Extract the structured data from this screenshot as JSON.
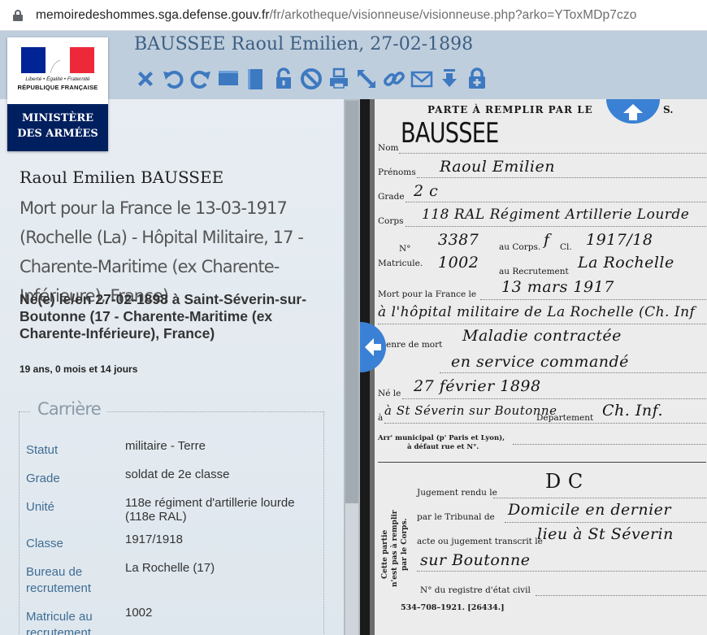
{
  "browser": {
    "url_host": "memoiredeshommes.sga.defense.gouv.fr",
    "url_path": "/fr/arkotheque/visionneuse/visionneuse.php?arko=YToxMDp7czo"
  },
  "header": {
    "title": "BAUSSEE Raoul Emilien, 27-02-1898",
    "toolbar": [
      {
        "name": "close-icon"
      },
      {
        "name": "rotate-left-icon"
      },
      {
        "name": "rotate-right-icon"
      },
      {
        "name": "fit-width-icon"
      },
      {
        "name": "fit-height-icon"
      },
      {
        "name": "unlock-icon"
      },
      {
        "name": "no-entry-icon"
      },
      {
        "name": "print-icon"
      },
      {
        "name": "fullscreen-icon"
      },
      {
        "name": "link-icon"
      },
      {
        "name": "mail-icon"
      },
      {
        "name": "download-icon"
      },
      {
        "name": "add-lock-icon"
      }
    ],
    "accent": "#3c5f82"
  },
  "logo": {
    "motto": "Liberté • Égalité • Fraternité",
    "republique": "RÉPUBLIQUE FRANÇAISE",
    "ministere_line1": "MINISTÈRE",
    "ministere_line2": "DES ARMÉES"
  },
  "person": {
    "name": "Raoul Emilien BAUSSEE",
    "death": "Mort pour la France le 13-03-1917 (Rochelle (La) - Hôpital Militaire, 17 - Charente-Maritime (ex Charente-Inférieure), France)",
    "birth": "Né(e) le/en 27-02-1898 à Saint-Séverin-sur-Boutonne (17 - Charente-Maritime (ex Charente-Inférieure), France)",
    "age": "19 ans, 0 mois et 14 jours"
  },
  "career": {
    "legend": "Carrière",
    "rows": [
      {
        "label": "Statut",
        "value": "militaire - Terre"
      },
      {
        "label": "Grade",
        "value": "soldat de 2e classe"
      },
      {
        "label": "Unité",
        "value": "118e régiment d'artillerie lourde (118e RAL)"
      },
      {
        "label": "Classe",
        "value": "1917/1918"
      },
      {
        "label": "Bureau de recrutement",
        "value": "La Rochelle (17)"
      },
      {
        "label": "Matricule au recrutement",
        "value": "1002"
      }
    ]
  },
  "document": {
    "header": "PARTE À REMPLIR PAR LE",
    "header_end": "S.",
    "printed": {
      "nom": "Nom",
      "prenoms": "Prénoms",
      "grade": "Grade",
      "corps": "Corps",
      "no": "N°",
      "matricule": "Matricule.",
      "au_corps": "au Corps.",
      "cl": "Cl.",
      "au_recrutement": "au Recrutement",
      "mort_pour": "Mort pour la France le",
      "a": "à",
      "genre": "enre de mort",
      "ne_le": "Né le",
      "departement": "Département",
      "arr": "Arr' municipal (p' Paris et Lyon),",
      "arr2": "à défaut rue et N°.",
      "jugement": "Jugement rendu le",
      "tribunal": "par le Tribunal de",
      "acte": "acte ou jugement transcrit le",
      "registre": "N° du registre d'état civil",
      "footer": "534–708–1921. [26434.]",
      "vertical1": "Cette partie",
      "vertical2": "n'est pas à remplir",
      "vertical3": "par le Corps."
    },
    "handwritten": {
      "nom": "BAUSSEE",
      "prenoms": "Raoul Emilien",
      "grade": "2 c",
      "corps": "118 RAL Régiment Artillerie Lourde",
      "no_corps": "3387",
      "cl_text": "f",
      "classe": "1917/18",
      "no_recrutement": "1002",
      "recrutement": "La Rochelle",
      "mort_le": "13 mars 1917",
      "lieu": "à l'hôpital militaire de La Rochelle (Ch. Inf",
      "genre1": "Maladie contractée",
      "genre2": "en service commandé",
      "ne_le": "27 février 1898",
      "ne_a": "à St Séverin sur Boutonne",
      "dept": "Ch. Inf.",
      "dc": "D C",
      "tribunal": "Domicile en dernier",
      "acte": "lieu à St Séverin",
      "acte2": "sur Boutonne"
    }
  }
}
